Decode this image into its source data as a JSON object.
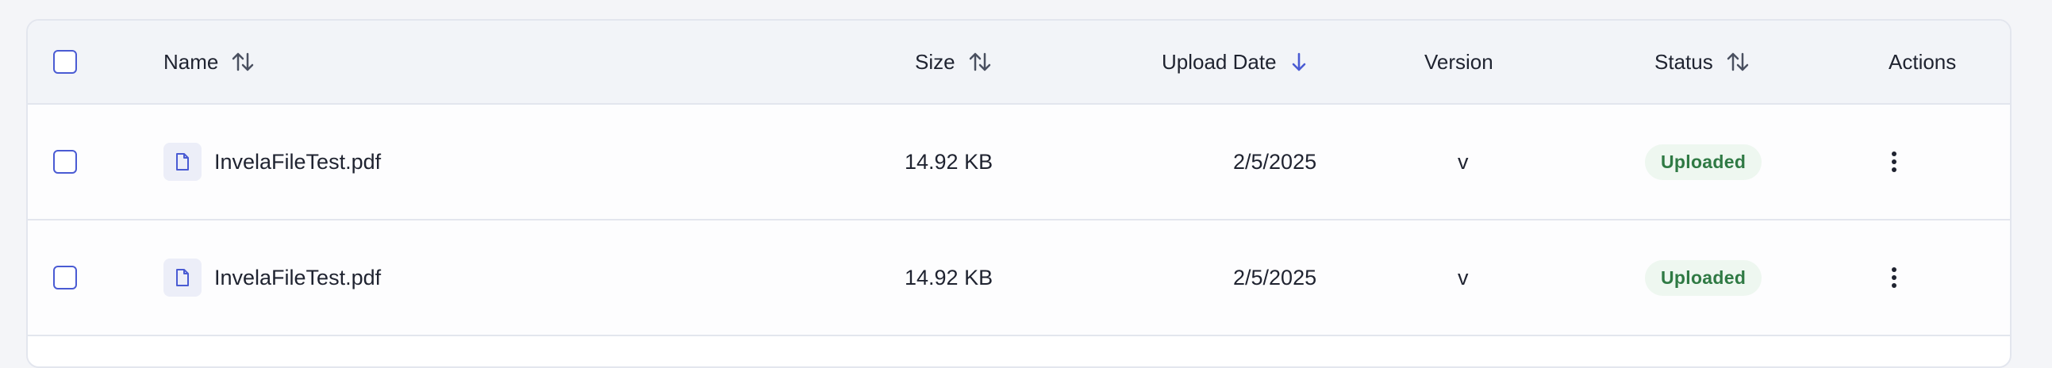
{
  "table": {
    "columns": {
      "name": "Name",
      "size": "Size",
      "upload_date": "Upload Date",
      "version": "Version",
      "status": "Status",
      "actions": "Actions"
    },
    "rows": [
      {
        "name": "InvelaFileTest.pdf",
        "size": "14.92 KB",
        "upload_date": "2/5/2025",
        "version": "v",
        "status": "Uploaded",
        "selected": false
      },
      {
        "name": "InvelaFileTest.pdf",
        "size": "14.92 KB",
        "upload_date": "2/5/2025",
        "version": "v",
        "status": "Uploaded",
        "selected": false
      }
    ],
    "select_all": false,
    "sorted_by": "upload_date",
    "sort_direction": "desc"
  },
  "icons": {
    "sort": "sort-arrows-icon",
    "sort_active": "arrow-down-icon",
    "file": "file-icon",
    "actions": "more-vertical-icon"
  },
  "colors": {
    "accent": "#4a5bd3",
    "status_text": "#2f7a44",
    "status_bg": "#eef7f0",
    "header_bg": "#f2f4f8",
    "border": "#e3e6ee"
  }
}
